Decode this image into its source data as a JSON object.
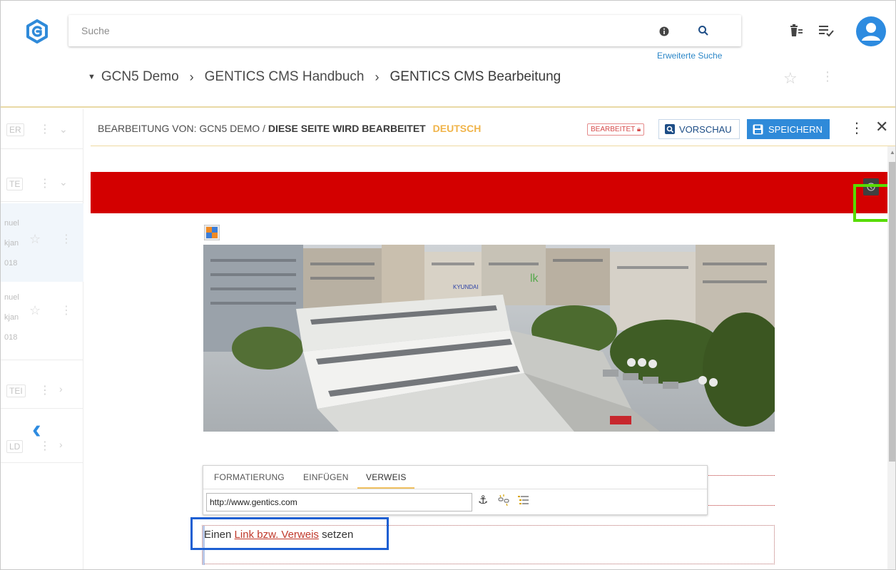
{
  "header": {
    "search_placeholder": "Suche",
    "advanced_search": "Erweiterte Suche"
  },
  "breadcrumb": {
    "items": [
      "GCN5 Demo",
      "GENTICS CMS Handbuch",
      "GENTICS CMS Bearbeitung"
    ]
  },
  "side_list": {
    "rows": [
      {
        "label": "ER"
      },
      {
        "label": "TE"
      },
      {
        "label": "TEI"
      },
      {
        "label": "LD"
      }
    ],
    "items": [
      {
        "line1": "nuel",
        "line2": "kjan",
        "line3": "018"
      },
      {
        "line1": "nuel",
        "line2": "kjan",
        "line3": "018"
      }
    ]
  },
  "editor": {
    "editing_prefix": "BEARBEITUNG VON:",
    "node_name": "GCN5 DEMO",
    "separator": "/",
    "page_name": "DIESE SEITE WIRD BEARBEITET",
    "language": "DEUTSCH",
    "status_badge": "BEARBEITET",
    "preview_label": "VORSCHAU",
    "save_label": "SPEICHERN"
  },
  "toolbar": {
    "tabs": [
      "FORMATIERUNG",
      "EINFÜGEN",
      "VERWEIS"
    ],
    "active_tab": "VERWEIS",
    "url_value": "http://www.gentics.com"
  },
  "content": {
    "text_before": "Einen ",
    "link_text": "Link bzw. Verweis",
    "text_after": " setzen"
  },
  "colors": {
    "accent_blue": "#2f8ad9",
    "banner_red": "#d30000",
    "language_orange": "#f0b44a",
    "highlight_green": "#58dc00",
    "highlight_blue": "#1d5fd2"
  }
}
